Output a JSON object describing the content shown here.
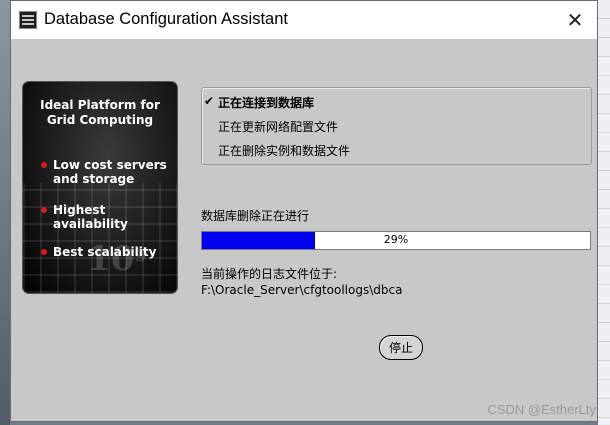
{
  "window": {
    "title": "Database Configuration Assistant",
    "close_glyph": "✕"
  },
  "banner": {
    "heading_line1": "Ideal Platform for",
    "heading_line2": "Grid Computing",
    "bullets": [
      {
        "line1": "Low cost servers",
        "line2": "and storage"
      },
      {
        "line1": "Highest availability",
        "line2": ""
      },
      {
        "line1": "Best scalability",
        "line2": ""
      }
    ],
    "brand_mark": "10",
    "brand_sup": "g"
  },
  "steps": [
    {
      "label": "正在连接到数据库",
      "status": "done"
    },
    {
      "label": "正在更新网络配置文件",
      "status": "pending"
    },
    {
      "label": "正在删除实例和数据文件",
      "status": "pending"
    }
  ],
  "check_glyph": "✔",
  "progress": {
    "label": "数据库删除正在进行",
    "percent": 29,
    "text": "29%",
    "fill_color": "#0000f0"
  },
  "log": {
    "label": "当前操作的日志文件位于:",
    "path": "F:\\Oracle_Server\\cfgtoollogs\\dbca"
  },
  "buttons": {
    "stop": "停止"
  },
  "watermark": "CSDN @EstherLty"
}
